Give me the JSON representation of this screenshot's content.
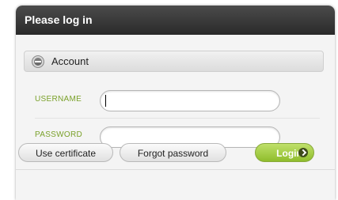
{
  "dialog": {
    "title": "Please log in"
  },
  "account_section": {
    "title": "Account",
    "icon": "collapse-icon"
  },
  "form": {
    "username_label": "USERNAME",
    "username_value": "",
    "password_label": "PASSWORD",
    "password_value": ""
  },
  "buttons": {
    "use_certificate": "Use certificate",
    "forgot_password": "Forgot password",
    "login": "Login"
  },
  "colors": {
    "accent_green": "#8fbd2c",
    "label_green": "#7aa12a",
    "titlebar": "#333333"
  }
}
